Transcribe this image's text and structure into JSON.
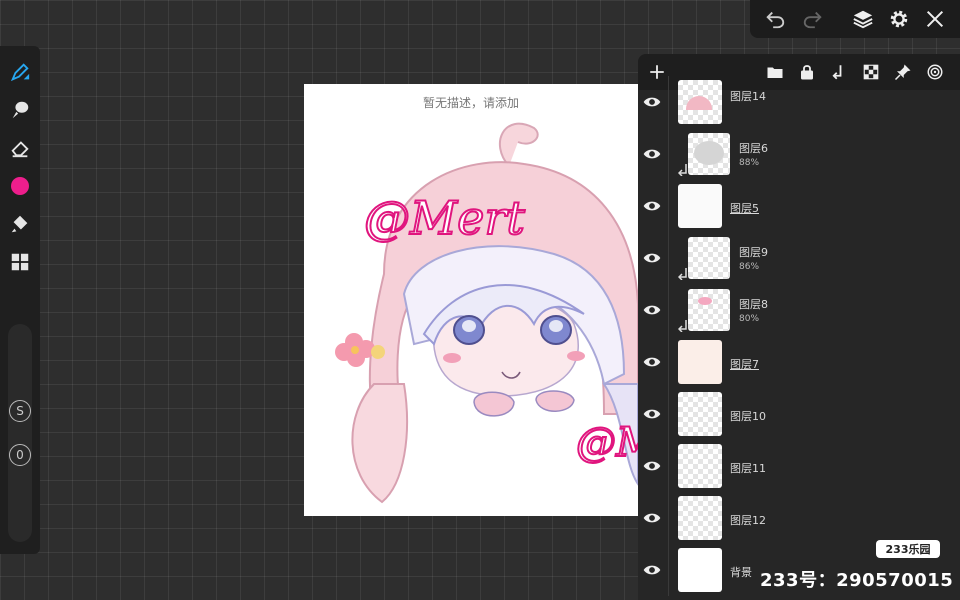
{
  "canvas": {
    "caption": "暂无描述，请添加"
  },
  "artwork": {
    "signature_text": "@Mert"
  },
  "left_toolbar": {
    "active_color": "#ee1e8c",
    "brush_size_label": "S",
    "opacity_label": "0",
    "tools": [
      "brush-icon",
      "smudge-icon",
      "eraser-icon",
      "color-swatch",
      "fill-icon",
      "layers-grid-icon"
    ]
  },
  "top_bar": {
    "buttons": [
      "undo-icon",
      "redo-icon",
      "layers-icon",
      "settings-icon",
      "close-icon"
    ]
  },
  "layers_panel": {
    "header_buttons": [
      "add-layer-icon",
      "folder-icon",
      "lock-icon",
      "clip-icon",
      "transparency-icon",
      "pin-icon",
      "blend-icon"
    ],
    "layers": [
      {
        "name": "图层14",
        "opacity": "",
        "clipped": false,
        "underlined": false
      },
      {
        "name": "图层6",
        "opacity": "88%",
        "clipped": true,
        "underlined": false
      },
      {
        "name": "图层5",
        "opacity": "",
        "clipped": false,
        "underlined": true
      },
      {
        "name": "图层9",
        "opacity": "86%",
        "clipped": true,
        "underlined": false
      },
      {
        "name": "图层8",
        "opacity": "80%",
        "clipped": true,
        "underlined": false
      },
      {
        "name": "图层7",
        "opacity": "",
        "clipped": false,
        "underlined": true
      },
      {
        "name": "图层10",
        "opacity": "",
        "clipped": false,
        "underlined": false
      },
      {
        "name": "图层11",
        "opacity": "",
        "clipped": false,
        "underlined": false
      },
      {
        "name": "图层12",
        "opacity": "",
        "clipped": false,
        "underlined": false
      },
      {
        "name": "背景",
        "opacity": "",
        "clipped": false,
        "underlined": false
      }
    ]
  },
  "watermark": {
    "badge": "233乐园",
    "id_text": "233号：290570015"
  }
}
